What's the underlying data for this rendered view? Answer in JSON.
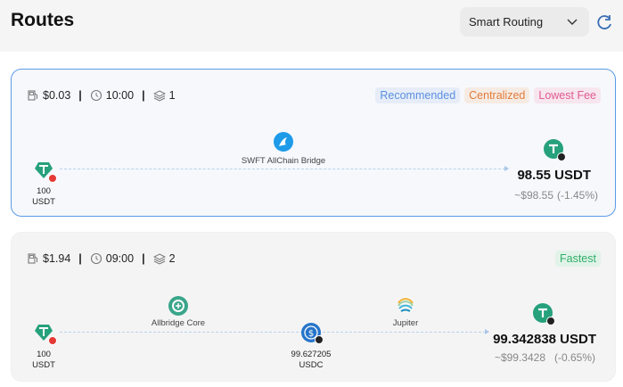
{
  "header": {
    "title": "Routes",
    "routing_mode": "Smart Routing"
  },
  "routes": [
    {
      "gas": "$0.03",
      "time": "10:00",
      "steps": "1",
      "tags": [
        "Recommended",
        "Centralized",
        "Lowest Fee"
      ],
      "input": {
        "amount": "100",
        "symbol": "USDT"
      },
      "hops": [
        {
          "bridge": "SWFT AllChain Bridge",
          "icon": "swft-icon"
        }
      ],
      "output": {
        "amount": "98.55 USDT",
        "usd": "~$98.55",
        "change": "(-1.45%)"
      }
    },
    {
      "gas": "$1.94",
      "time": "09:00",
      "steps": "2",
      "tags": [
        "Fastest"
      ],
      "input": {
        "amount": "100",
        "symbol": "USDT"
      },
      "hops": [
        {
          "bridge": "Allbridge Core",
          "icon": "allbridge-icon"
        },
        {
          "bridge": "Jupiter",
          "icon": "jupiter-icon"
        }
      ],
      "intermediate": {
        "amount": "99.627205",
        "symbol": "USDC"
      },
      "output": {
        "amount": "99.342838 USDT",
        "usd": "~$99.3428",
        "change": "(-0.65%)"
      }
    }
  ],
  "colors": {
    "selected_border": "#5b9be6",
    "usdt_green": "#26a17b",
    "usdc_blue": "#2775ca",
    "tron_red": "#e53935"
  }
}
